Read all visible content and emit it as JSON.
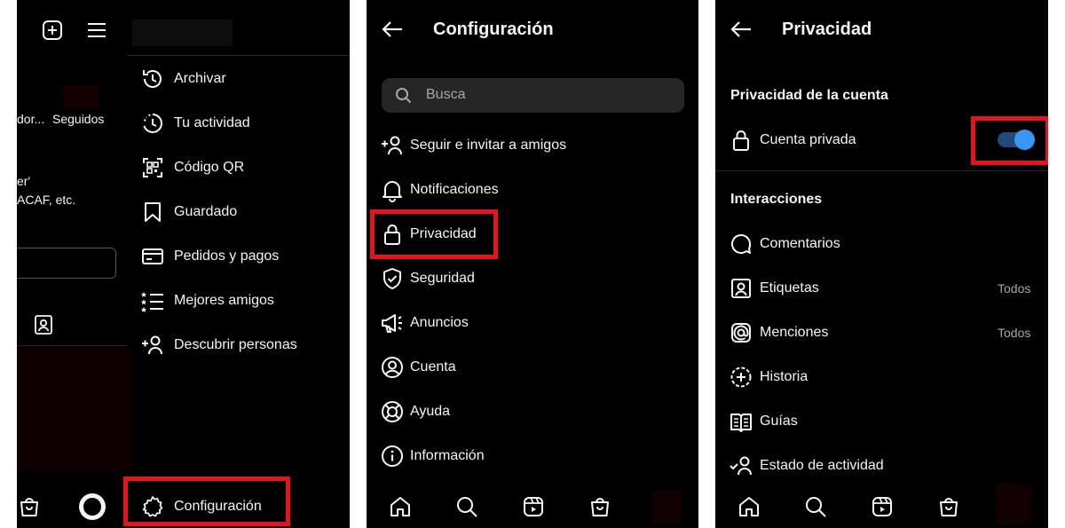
{
  "panel_menu": {
    "items": [
      {
        "label": "Archivar",
        "icon": "history-icon"
      },
      {
        "label": "Tu actividad",
        "icon": "activity-icon"
      },
      {
        "label": "Código QR",
        "icon": "qr-code-icon"
      },
      {
        "label": "Guardado",
        "icon": "bookmark-icon"
      },
      {
        "label": "Pedidos y pagos",
        "icon": "card-icon"
      },
      {
        "label": "Mejores amigos",
        "icon": "best-friends-list-icon"
      },
      {
        "label": "Descubrir personas",
        "icon": "add-person-icon"
      }
    ],
    "settings_label": "Configuración",
    "profile_fragments": {
      "followers_partial": "dor...",
      "following": "Seguidos",
      "bio_partial_1": "er'",
      "bio_partial_2": "ACAF, etc."
    }
  },
  "panel_settings": {
    "title": "Configuración",
    "search_placeholder": "Busca",
    "items": [
      {
        "label": "Seguir e invitar a amigos",
        "icon": "add-person-icon"
      },
      {
        "label": "Notificaciones",
        "icon": "bell-icon"
      },
      {
        "label": "Privacidad",
        "icon": "lock-icon"
      },
      {
        "label": "Seguridad",
        "icon": "shield-check-icon"
      },
      {
        "label": "Anuncios",
        "icon": "megaphone-icon"
      },
      {
        "label": "Cuenta",
        "icon": "account-icon"
      },
      {
        "label": "Ayuda",
        "icon": "help-icon"
      },
      {
        "label": "Información",
        "icon": "info-icon"
      }
    ]
  },
  "panel_privacy": {
    "title": "Privacidad",
    "section_account": "Privacidad de la cuenta",
    "private_account_label": "Cuenta privada",
    "private_account_enabled": true,
    "section_interactions": "Interacciones",
    "items": [
      {
        "label": "Comentarios",
        "value": "",
        "icon": "comment-icon"
      },
      {
        "label": "Etiquetas",
        "value": "Todos",
        "icon": "tag-person-icon"
      },
      {
        "label": "Menciones",
        "value": "Todos",
        "icon": "mention-icon"
      },
      {
        "label": "Historia",
        "value": "",
        "icon": "story-add-icon"
      },
      {
        "label": "Guías",
        "value": "",
        "icon": "guides-icon"
      },
      {
        "label": "Estado de actividad",
        "value": "",
        "icon": "activity-status-icon"
      }
    ]
  },
  "colors": {
    "background": "#000000",
    "text": "#f5f5f5",
    "secondary_text": "#a8a8a8",
    "highlight": "#e3141b",
    "toggle_accent": "#3897f0",
    "search_bg": "#262626"
  }
}
